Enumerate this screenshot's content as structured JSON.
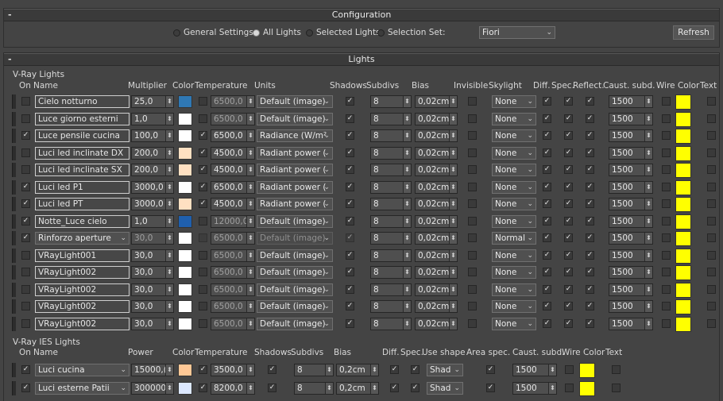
{
  "config": {
    "title": "Configuration",
    "options": [
      {
        "label": "General Settings",
        "selected": false
      },
      {
        "label": "All Lights",
        "selected": true
      },
      {
        "label": "Selected Lights",
        "selected": false
      },
      {
        "label": "Selection Set:",
        "selected": false
      }
    ],
    "selection_set": "Fiori",
    "refresh_label": "Refresh"
  },
  "lights": {
    "title": "Lights",
    "vray_section_label": "V-Ray Lights",
    "vray_headers": {
      "on": "On",
      "name": "Name",
      "multiplier": "Multiplier",
      "color": "Color",
      "temperature": "Temperature",
      "units": "Units",
      "shadows": "Shadows",
      "subdivs": "Subdivs",
      "bias": "Bias",
      "invisible": "Invisible",
      "skylight": "Skylight",
      "diff": "Diff.",
      "spec": "Spec.",
      "reflect": "Reflect.",
      "caust": "Caust. subd.",
      "wire": "Wire Color",
      "text": "Text"
    },
    "vray_rows": [
      {
        "on": false,
        "name": "Cielo notturno",
        "mult": "25,0",
        "color": "#2f78b4",
        "temp_on": false,
        "temp": "6500,0",
        "units": "Default (image)",
        "shadows": true,
        "subdivs": "8",
        "bias": "0,02cm",
        "invisible": false,
        "skylight": "None",
        "diff": true,
        "spec": true,
        "refl": true,
        "caust": "1500",
        "wire": false,
        "wire_color": "#ffff00",
        "text": false,
        "dropdown": false,
        "disabled": false
      },
      {
        "on": false,
        "name": "Luce giorno esterni",
        "mult": "1,0",
        "color": "#ffffff",
        "temp_on": false,
        "temp": "6500,0",
        "units": "Default (image)",
        "shadows": true,
        "subdivs": "8",
        "bias": "0,02cm",
        "invisible": false,
        "skylight": "None",
        "diff": true,
        "spec": true,
        "refl": true,
        "caust": "1500",
        "wire": false,
        "wire_color": "#ffff00",
        "text": false,
        "dropdown": false,
        "disabled": false
      },
      {
        "on": true,
        "name": "Luce pensile cucina",
        "mult": "100,0",
        "color": "#ffffff",
        "temp_on": true,
        "temp": "6500,0",
        "units": "Radiance (W/m²",
        "shadows": true,
        "subdivs": "8",
        "bias": "0,02cm",
        "invisible": false,
        "skylight": "None",
        "diff": true,
        "spec": true,
        "refl": true,
        "caust": "1500",
        "wire": false,
        "wire_color": "#ffff00",
        "text": false,
        "dropdown": false,
        "disabled": false
      },
      {
        "on": false,
        "name": "Luci led inclinate DX",
        "mult": "200,0",
        "color": "#ffe0c2",
        "temp_on": true,
        "temp": "4500,0",
        "units": "Radiant power (",
        "shadows": true,
        "subdivs": "8",
        "bias": "0,02cm",
        "invisible": false,
        "skylight": "None",
        "diff": true,
        "spec": true,
        "refl": true,
        "caust": "1500",
        "wire": false,
        "wire_color": "#ffff00",
        "text": false,
        "dropdown": false,
        "disabled": false
      },
      {
        "on": false,
        "name": "Luci led inclinate SX",
        "mult": "200,0",
        "color": "#ffe0c2",
        "temp_on": true,
        "temp": "4500,0",
        "units": "Radiant power (",
        "shadows": true,
        "subdivs": "8",
        "bias": "0,02cm",
        "invisible": false,
        "skylight": "None",
        "diff": true,
        "spec": true,
        "refl": true,
        "caust": "1500",
        "wire": false,
        "wire_color": "#ffff00",
        "text": false,
        "dropdown": false,
        "disabled": false
      },
      {
        "on": true,
        "name": "Luci led P1",
        "mult": "3000,0",
        "color": "#ffffff",
        "temp_on": true,
        "temp": "6500,0",
        "units": "Radiant power (",
        "shadows": true,
        "subdivs": "8",
        "bias": "0,02cm",
        "invisible": false,
        "skylight": "None",
        "diff": true,
        "spec": true,
        "refl": true,
        "caust": "1500",
        "wire": false,
        "wire_color": "#ffff00",
        "text": false,
        "dropdown": false,
        "disabled": false
      },
      {
        "on": true,
        "name": "Luci led PT",
        "mult": "3000,0",
        "color": "#ffe0c2",
        "temp_on": true,
        "temp": "4500,0",
        "units": "Radiant power (",
        "shadows": true,
        "subdivs": "8",
        "bias": "0,02cm",
        "invisible": false,
        "skylight": "None",
        "diff": true,
        "spec": true,
        "refl": true,
        "caust": "1500",
        "wire": false,
        "wire_color": "#ffff00",
        "text": false,
        "dropdown": false,
        "disabled": false
      },
      {
        "on": true,
        "name": "Notte_Luce cielo",
        "mult": "1,0",
        "color": "#1f5fad",
        "temp_on": false,
        "temp": "12000,0",
        "units": "Default (image)",
        "shadows": true,
        "subdivs": "8",
        "bias": "0,02cm",
        "invisible": false,
        "skylight": "None",
        "diff": true,
        "spec": true,
        "refl": true,
        "caust": "1500",
        "wire": false,
        "wire_color": "#ffff00",
        "text": false,
        "dropdown": false,
        "disabled": false
      },
      {
        "on": true,
        "name": "Rinforzo aperture",
        "mult": "30,0",
        "color": "#ffffff",
        "temp_on": false,
        "temp": "6500,0",
        "units": "Default (image)",
        "shadows": true,
        "subdivs": "8",
        "bias": "0,02cm",
        "invisible": false,
        "skylight": "Normal",
        "diff": true,
        "spec": true,
        "refl": true,
        "caust": "1500",
        "wire": false,
        "wire_color": "#ffff00",
        "text": false,
        "dropdown": true,
        "disabled": true
      },
      {
        "on": false,
        "name": "VRayLight001",
        "mult": "30,0",
        "color": "#ffffff",
        "temp_on": false,
        "temp": "6500,0",
        "units": "Default (image)",
        "shadows": true,
        "subdivs": "8",
        "bias": "0,02cm",
        "invisible": false,
        "skylight": "None",
        "diff": true,
        "spec": true,
        "refl": true,
        "caust": "1500",
        "wire": false,
        "wire_color": "#ffff00",
        "text": false,
        "dropdown": false,
        "disabled": false
      },
      {
        "on": false,
        "name": "VRayLight002",
        "mult": "30,0",
        "color": "#ffffff",
        "temp_on": false,
        "temp": "6500,0",
        "units": "Default (image)",
        "shadows": true,
        "subdivs": "8",
        "bias": "0,02cm",
        "invisible": false,
        "skylight": "None",
        "diff": true,
        "spec": true,
        "refl": true,
        "caust": "1500",
        "wire": false,
        "wire_color": "#ffff00",
        "text": false,
        "dropdown": false,
        "disabled": false
      },
      {
        "on": false,
        "name": "VRayLight002",
        "mult": "30,0",
        "color": "#ffffff",
        "temp_on": false,
        "temp": "6500,0",
        "units": "Default (image)",
        "shadows": true,
        "subdivs": "8",
        "bias": "0,02cm",
        "invisible": false,
        "skylight": "None",
        "diff": true,
        "spec": true,
        "refl": true,
        "caust": "1500",
        "wire": false,
        "wire_color": "#ffff00",
        "text": false,
        "dropdown": false,
        "disabled": false
      },
      {
        "on": false,
        "name": "VRayLight002",
        "mult": "30,0",
        "color": "#ffffff",
        "temp_on": false,
        "temp": "6500,0",
        "units": "Default (image)",
        "shadows": true,
        "subdivs": "8",
        "bias": "0,02cm",
        "invisible": false,
        "skylight": "None",
        "diff": true,
        "spec": true,
        "refl": true,
        "caust": "1500",
        "wire": false,
        "wire_color": "#ffff00",
        "text": false,
        "dropdown": false,
        "disabled": false
      },
      {
        "on": false,
        "name": "VRayLight002",
        "mult": "30,0",
        "color": "#ffffff",
        "temp_on": false,
        "temp": "6500,0",
        "units": "Default (image)",
        "shadows": true,
        "subdivs": "8",
        "bias": "0,02cm",
        "invisible": false,
        "skylight": "None",
        "diff": true,
        "spec": true,
        "refl": true,
        "caust": "1500",
        "wire": false,
        "wire_color": "#ffff00",
        "text": false,
        "dropdown": false,
        "disabled": false
      }
    ],
    "ies_section_label": "V-Ray IES Lights",
    "ies_headers": {
      "on": "On",
      "name": "Name",
      "power": "Power",
      "color": "Color",
      "temperature": "Temperature",
      "shadows": "Shadows",
      "subdivs": "Subdivs",
      "bias": "Bias",
      "diff": "Diff.",
      "spec": "Spec.",
      "use_shape": "Use shape",
      "area_spec": "Area spec.",
      "caust": "Caust. subd.",
      "wire": "Wire Color",
      "text": "Text"
    },
    "ies_rows": [
      {
        "on": true,
        "name": "Luci cucina",
        "power": "15000,(",
        "color": "#ffc896",
        "temp_on": true,
        "temp": "3500,0",
        "shadows": true,
        "subdivs": "8",
        "bias": "0,2cm",
        "diff": true,
        "spec": true,
        "shape": "Shad",
        "area_spec": true,
        "caust": "1500",
        "wire": false,
        "wire_color": "#ffff00",
        "text": false
      },
      {
        "on": true,
        "name": "Luci esterne Patii",
        "power": "300000",
        "color": "#dce8ff",
        "temp_on": true,
        "temp": "8200,0",
        "shadows": true,
        "subdivs": "8",
        "bias": "0,2cm",
        "diff": true,
        "spec": true,
        "shape": "Shad",
        "area_spec": true,
        "caust": "1500",
        "wire": false,
        "wire_color": "#ffff00",
        "text": false
      }
    ]
  }
}
